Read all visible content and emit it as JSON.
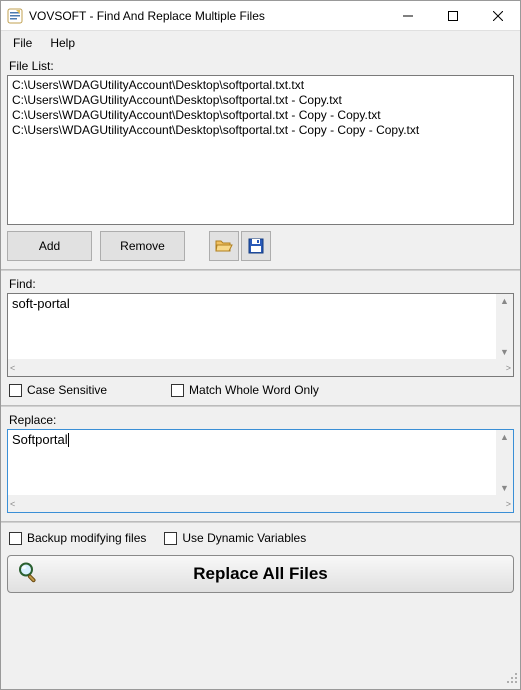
{
  "window": {
    "title": "VOVSOFT - Find And Replace Multiple Files"
  },
  "menu": {
    "file": "File",
    "help": "Help"
  },
  "labels": {
    "filelist": "File List:",
    "find": "Find:",
    "replace": "Replace:"
  },
  "filelist": [
    "C:\\Users\\WDAGUtilityAccount\\Desktop\\softportal.txt.txt",
    "C:\\Users\\WDAGUtilityAccount\\Desktop\\softportal.txt - Copy.txt",
    "C:\\Users\\WDAGUtilityAccount\\Desktop\\softportal.txt - Copy - Copy.txt",
    "C:\\Users\\WDAGUtilityAccount\\Desktop\\softportal.txt - Copy - Copy - Copy.txt"
  ],
  "buttons": {
    "add": "Add",
    "remove": "Remove",
    "replace_all": "Replace All Files"
  },
  "find": {
    "text": "soft-portal"
  },
  "replace": {
    "text": "Softportal"
  },
  "checks": {
    "case_sensitive": "Case Sensitive",
    "match_whole": "Match Whole Word Only",
    "backup": "Backup modifying files",
    "dynamic": "Use Dynamic Variables"
  }
}
